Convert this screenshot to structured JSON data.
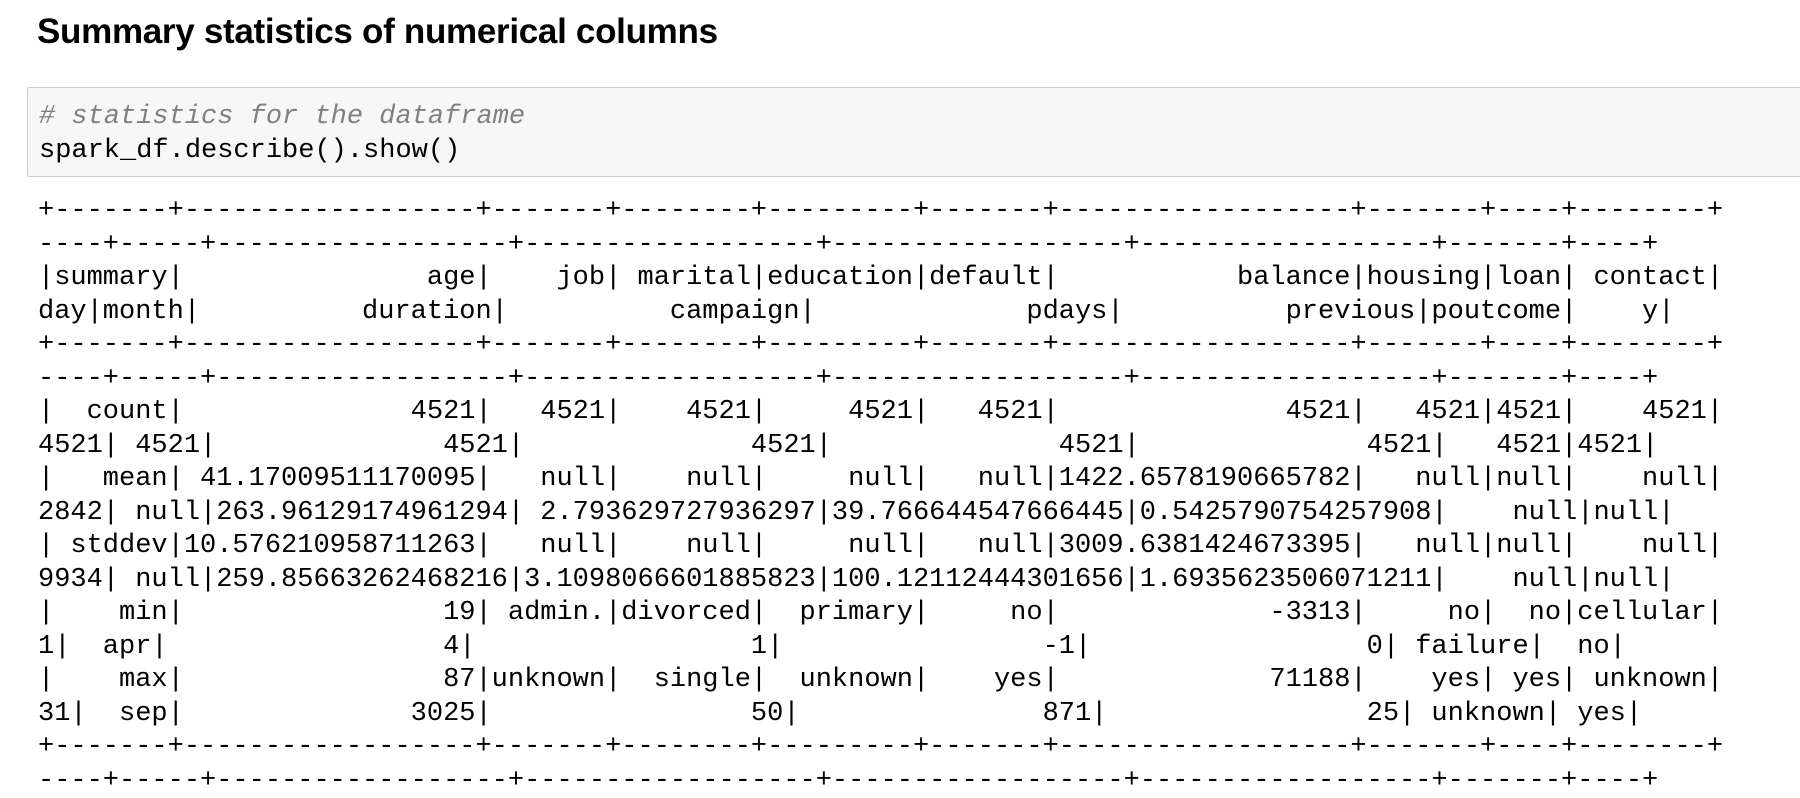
{
  "heading": "Summary statistics of numerical columns",
  "code_cell": {
    "comment": "# statistics for the dataframe",
    "statement": "spark_df.describe().show()"
  },
  "output_lines": [
    "+-------+------------------+-------+--------+---------+-------+------------------+-------+----+--------+",
    "----+-----+------------------+------------------+------------------+------------------+-------+----+",
    "|summary|               age|    job| marital|education|default|           balance|housing|loan| contact|",
    "day|month|          duration|          campaign|             pdays|          previous|poutcome|    y|",
    "+-------+------------------+-------+--------+---------+-------+------------------+-------+----+--------+",
    "----+-----+------------------+------------------+------------------+------------------+-------+----+",
    "|  count|              4521|   4521|    4521|     4521|   4521|              4521|   4521|4521|    4521|",
    "4521| 4521|              4521|              4521|              4521|              4521|   4521|4521|",
    "|   mean| 41.17009511170095|   null|    null|     null|   null|1422.6578190665782|   null|null|    null|",
    "2842| null|263.96129174961294| 2.793629727936297|39.766644547666445|0.5425790754257908|    null|null|",
    "| stddev|10.576210958711263|   null|    null|     null|   null|3009.6381424673395|   null|null|    null|",
    "9934| null|259.85663262468216|3.1098066601885823|100.12112444301656|1.6935623506071211|    null|null|",
    "|    min|                19| admin.|divorced|  primary|     no|             -3313|     no|  no|cellular|",
    "1|  apr|                 4|                 1|                -1|                 0| failure|  no|",
    "|    max|                87|unknown|  single|  unknown|    yes|             71188|    yes| yes| unknown|",
    "31|  sep|              3025|                50|               871|                25| unknown| yes|",
    "+-------+------------------+-------+--------+---------+-------+------------------+-------+----+--------+",
    "----+-----+------------------+------------------+------------------+------------------+-------+----+"
  ]
}
